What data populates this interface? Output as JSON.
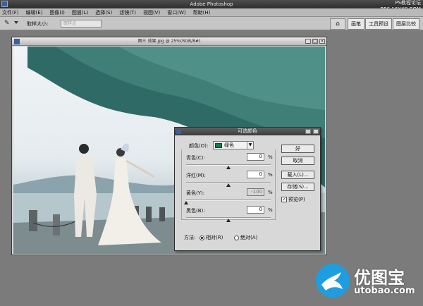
{
  "window": {
    "title": "Adobe Photoshop",
    "watermark": [
      "PS教程论坛",
      "BBS.16XX8.COM"
    ]
  },
  "menu": [
    "文件(F)",
    "编辑(E)",
    "图像(I)",
    "图层(L)",
    "选择(S)",
    "滤镜(T)",
    "视图(V)",
    "窗口(W)",
    "帮助(H)"
  ],
  "options_bar": {
    "sample_size_label": "取样大小:",
    "sample_size_value": "取样点"
  },
  "panel_tabs": [
    "画笔",
    "工具预设",
    "图层比较"
  ],
  "document": {
    "title": "图三 效果.jpg @ 25%(RGB/8#)"
  },
  "dialog": {
    "title": "可选颜色",
    "color_label": "颜色(O):",
    "color_value": "绿色",
    "color_swatch": "#137b45",
    "sliders": [
      {
        "label": "青色(C):",
        "value": "0",
        "unit": "%",
        "level": 0
      },
      {
        "label": "洋红(M):",
        "value": "0",
        "unit": "%",
        "level": 0
      },
      {
        "label": "黄色(Y):",
        "value": "-100",
        "unit": "%",
        "level": -100
      },
      {
        "label": "黑色(B):",
        "value": "0",
        "unit": "%",
        "level": 0
      }
    ],
    "buttons": {
      "ok": "好",
      "cancel": "取消",
      "load": "载入(L)...",
      "save": "存储(S)..."
    },
    "preview_label": "预览(P)",
    "preview_checked": true,
    "method_label": "方法:",
    "method_relative": "相对(R)",
    "method_absolute": "绝对(A)",
    "method_selected": "relative"
  },
  "logo": {
    "title": "优图宝",
    "url": "utobao.com"
  }
}
